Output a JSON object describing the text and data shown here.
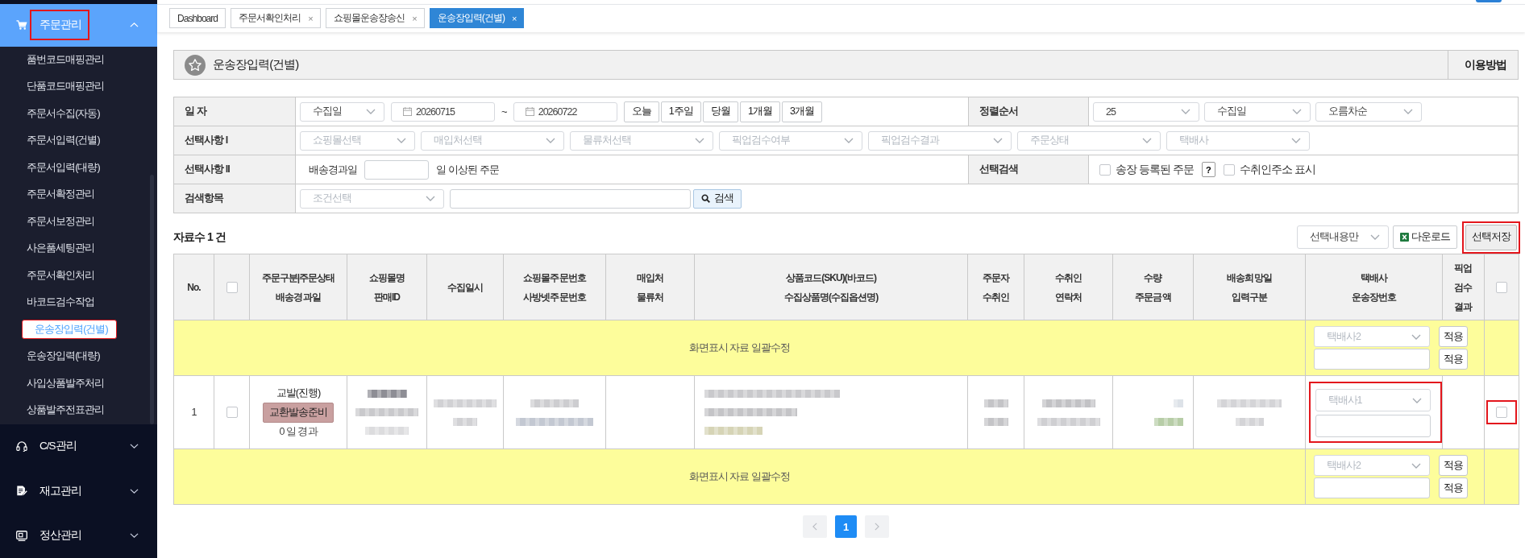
{
  "sidebar": {
    "sections": [
      {
        "label": "주문관리",
        "expanded": true,
        "highlighted": true,
        "items": [
          {
            "label": "품번코드매핑관리",
            "selected": false,
            "highlighted": false
          },
          {
            "label": "단품코드매핑관리",
            "selected": false,
            "highlighted": false
          },
          {
            "label": "주문서수집(자동)",
            "selected": false,
            "highlighted": false
          },
          {
            "label": "주문서입력(건별)",
            "selected": false,
            "highlighted": false
          },
          {
            "label": "주문서입력(대량)",
            "selected": false,
            "highlighted": false
          },
          {
            "label": "주문서확정관리",
            "selected": false,
            "highlighted": false
          },
          {
            "label": "주문서보정관리",
            "selected": false,
            "highlighted": false
          },
          {
            "label": "사은품세팅관리",
            "selected": false,
            "highlighted": false
          },
          {
            "label": "주문서확인처리",
            "selected": false,
            "highlighted": false
          },
          {
            "label": "바코드검수작업",
            "selected": false,
            "highlighted": false
          },
          {
            "label": "운송장입력(건별)",
            "selected": true,
            "highlighted": true
          },
          {
            "label": "운송장입력(대량)",
            "selected": false,
            "highlighted": false
          },
          {
            "label": "사입상품발주처리",
            "selected": false,
            "highlighted": false
          },
          {
            "label": "상품발주전표관리",
            "selected": false,
            "highlighted": false
          }
        ]
      },
      {
        "label": "C/S관리",
        "expanded": false,
        "highlighted": false
      },
      {
        "label": "재고관리",
        "expanded": false,
        "highlighted": false
      },
      {
        "label": "정산관리",
        "expanded": false,
        "highlighted": false
      }
    ]
  },
  "tabs": [
    {
      "label": "Dashboard",
      "selected": false
    },
    {
      "label": "주문서확인처리",
      "selected": false,
      "close": "×"
    },
    {
      "label": "쇼핑몰운송장송신",
      "selected": false,
      "close": "×"
    },
    {
      "label": "운송장입력(건별)",
      "selected": true,
      "close": "×"
    }
  ],
  "page_header": {
    "title": "운송장입력(건별)",
    "help_button": "이용방법"
  },
  "filters": {
    "date": {
      "label": "일 자",
      "basis": {
        "value": "수집일"
      },
      "from": "20260715",
      "separator": "~",
      "to": "20260722",
      "quick_buttons": [
        "오늘",
        "1주일",
        "당월",
        "1개월",
        "3개월"
      ]
    },
    "sort": {
      "label": "정렬순서",
      "selects": [
        {
          "value": "25"
        },
        {
          "value": "수집일"
        },
        {
          "value": "오름차순"
        }
      ]
    },
    "options_1": {
      "label": "선택사항 I",
      "selects": [
        {
          "placeholder": "쇼핑몰선택"
        },
        {
          "placeholder": "매입처선택"
        },
        {
          "placeholder": "물류처선택"
        },
        {
          "placeholder": "픽업검수여부"
        },
        {
          "placeholder": "픽업검수결과"
        },
        {
          "placeholder": "주문상태"
        },
        {
          "placeholder": "택배사"
        }
      ]
    },
    "options_2": {
      "label": "선택사항 II",
      "prefix": "배송경과일",
      "suffix": "일 이상된 주문"
    },
    "select_search": {
      "label": "선택검색",
      "checks": [
        {
          "label": "송장 등록된 주문",
          "checked": false,
          "help": "?"
        },
        {
          "label": "수취인주소 표시",
          "checked": false
        }
      ]
    },
    "search": {
      "label": "검색항목",
      "condition": {
        "placeholder": "조건선택"
      },
      "button": "검색"
    }
  },
  "toolbar": {
    "count": "자료수 1 건",
    "scope": {
      "value": "선택내용만"
    },
    "download_button": "다운로드",
    "save_button": {
      "label": "선택저장",
      "highlighted": true
    }
  },
  "table": {
    "columns": [
      {
        "kind": "text",
        "lines": [
          "No."
        ]
      },
      {
        "kind": "checkbox",
        "checked": false
      },
      {
        "kind": "text",
        "lines": [
          "주문구분|주문상태",
          "배송경과일"
        ]
      },
      {
        "kind": "text",
        "lines": [
          "쇼핑몰명",
          "판매ID"
        ]
      },
      {
        "kind": "text",
        "lines": [
          "수집일시"
        ]
      },
      {
        "kind": "text",
        "lines": [
          "쇼핑몰주문번호",
          "사방넷주문번호"
        ]
      },
      {
        "kind": "text",
        "lines": [
          "매입처",
          "물류처"
        ]
      },
      {
        "kind": "text",
        "lines": [
          "상품코드(SKU)(바코드)",
          "수집상품명(수집옵션명)"
        ]
      },
      {
        "kind": "text",
        "lines": [
          "주문자",
          "수취인"
        ]
      },
      {
        "kind": "text",
        "lines": [
          "수취인",
          "연락처"
        ]
      },
      {
        "kind": "text",
        "lines": [
          "수량",
          "주문금액"
        ]
      },
      {
        "kind": "text",
        "lines": [
          "배송희망일",
          "입력구분"
        ]
      },
      {
        "kind": "text",
        "lines": [
          "택배사",
          "운송장번호"
        ]
      },
      {
        "kind": "text",
        "lines": [
          "픽업",
          "검수",
          "결과"
        ]
      },
      {
        "kind": "checkbox",
        "checked": false
      }
    ],
    "rows": [
      {
        "kind": "bulk",
        "label": "화면표시 자료 일괄수정",
        "courier": {
          "placeholder": "택배사2"
        },
        "apply_buttons": [
          "적용",
          "적용"
        ]
      },
      {
        "kind": "order",
        "no": "1",
        "checked": false,
        "order_type": "교발(진행)",
        "status": "교환발송준비",
        "elapsed": "0 일 경과",
        "redacted": true,
        "courier": {
          "placeholder": "택배사1"
        },
        "courier_highlighted": true,
        "end_checked": false,
        "end_highlighted": true
      },
      {
        "kind": "bulk",
        "label": "화면표시 자료 일괄수정",
        "courier": {
          "placeholder": "택배사2"
        },
        "apply_buttons": [
          "적용",
          "적용"
        ]
      }
    ]
  },
  "pagination": {
    "pages": [
      {
        "label": "1",
        "selected": true
      }
    ]
  }
}
